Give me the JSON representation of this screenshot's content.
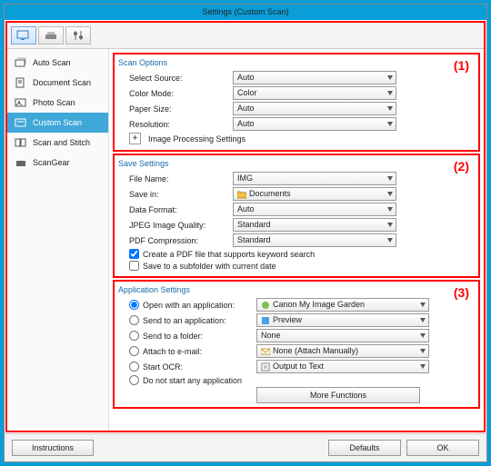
{
  "title": "Settings (Custom Scan)",
  "annotations": {
    "s1": "(1)",
    "s2": "(2)",
    "s3": "(3)"
  },
  "sidebar": {
    "items": [
      {
        "label": "Auto Scan"
      },
      {
        "label": "Document Scan"
      },
      {
        "label": "Photo Scan"
      },
      {
        "label": "Custom Scan"
      },
      {
        "label": "Scan and Stitch"
      },
      {
        "label": "ScanGear"
      }
    ]
  },
  "scan": {
    "heading": "Scan Options",
    "source_label": "Select Source:",
    "source_value": "Auto",
    "color_label": "Color Mode:",
    "color_value": "Color",
    "paper_label": "Paper Size:",
    "paper_value": "Auto",
    "res_label": "Resolution:",
    "res_value": "Auto",
    "ip_label": "Image Processing Settings",
    "expand": "+"
  },
  "save": {
    "heading": "Save Settings",
    "file_label": "File Name:",
    "file_value": "IMG",
    "savein_label": "Save in:",
    "savein_value": "Documents",
    "format_label": "Data Format:",
    "format_value": "Auto",
    "jpeg_label": "JPEG Image Quality:",
    "jpeg_value": "Standard",
    "pdf_label": "PDF Compression:",
    "pdf_value": "Standard",
    "chk1": "Create a PDF file that supports keyword search",
    "chk2": "Save to a subfolder with current date"
  },
  "app": {
    "heading": "Application Settings",
    "r1": "Open with an application:",
    "r1v": "Canon My Image Garden",
    "r2": "Send to an application:",
    "r2v": "Preview",
    "r3": "Send to a folder:",
    "r3v": "None",
    "r4": "Attach to e-mail:",
    "r4v": "None (Attach Manually)",
    "r5": "Start OCR:",
    "r5v": "Output to Text",
    "r6": "Do not start any application",
    "more": "More Functions"
  },
  "footer": {
    "instructions": "Instructions",
    "defaults": "Defaults",
    "ok": "OK"
  }
}
